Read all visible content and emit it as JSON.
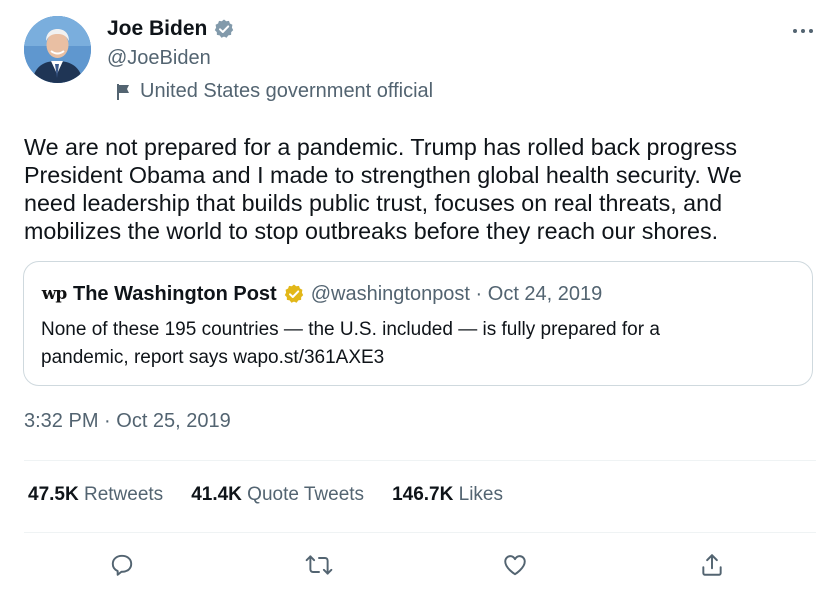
{
  "author": {
    "name": "Joe Biden",
    "handle": "@JoeBiden",
    "label": "United States government official"
  },
  "tweet": {
    "text": "We are not prepared for a pandemic. Trump has rolled back progress\nPresident Obama and I made to strengthen global health security. We\nneed leadership that builds public trust, focuses on real threats, and\nmobilizes the world to stop outbreaks before they reach our shores.",
    "timestamp": "3:32 PM · Oct 25, 2019"
  },
  "quoted_tweet": {
    "logo": "wp",
    "name": "The Washington Post",
    "meta": "@washingtonpost · Oct 24, 2019",
    "text": "None of these 195 countries — the U.S. included — is fully prepared for a\npandemic, report says wapo.st/361AXE3"
  },
  "stats": [
    {
      "value": "47.5K",
      "label": "Retweets"
    },
    {
      "value": "41.4K",
      "label": "Quote Tweets"
    },
    {
      "value": "146.7K",
      "label": "Likes"
    }
  ],
  "icons": {
    "verified": "verified-badge-gray",
    "quote_verified": "verified-badge-gold",
    "more": "more-icon",
    "gov": "flag-icon",
    "reply": "reply-icon",
    "retweet": "retweet-icon",
    "like": "like-icon",
    "share": "share-icon"
  },
  "colors": {
    "text_primary": "#0f1419",
    "text_secondary": "#536471",
    "border": "#cfd9de",
    "verified_gold": "#e2b719",
    "verified_gray": "#829aab"
  }
}
